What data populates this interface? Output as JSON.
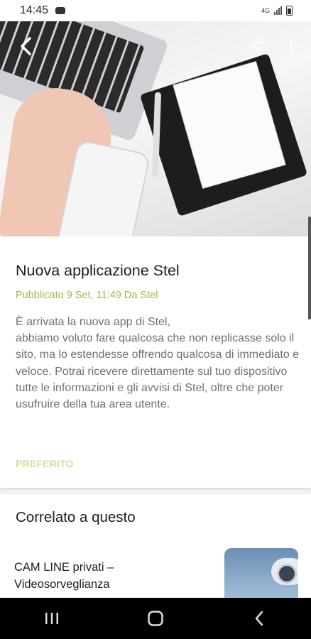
{
  "status_bar": {
    "time": "14:45",
    "network": "4G"
  },
  "article": {
    "title": "Nuova applicazione Stel",
    "meta": "Pubblicato 9 Set, 11:49 Da Stel",
    "body": "È arrivata la nuova app di Stel,\nabbiamo voluto fare qualcosa che non replicasse solo il sito, ma lo estendesse offrendo qualcosa di immediato e veloce. Potrai ricevere direttamente sul tuo dispositivo tutte le informazioni e gli avvisi di Stel, oltre che poter usufruire della tua area utente.",
    "favorite_label": "PREFERITO"
  },
  "related": {
    "title": "Correlato a questo",
    "items": [
      {
        "title": "CAM LINE privati – Videosorveglianza"
      }
    ]
  },
  "icons": {
    "back": "back-arrow-icon",
    "share": "share-icon",
    "more": "more-vert-icon",
    "recents": "recents-icon",
    "home": "home-icon",
    "nav_back": "nav-back-icon"
  },
  "colors": {
    "meta_accent": "#a9b34b",
    "favorite": "#d4dd9c"
  }
}
